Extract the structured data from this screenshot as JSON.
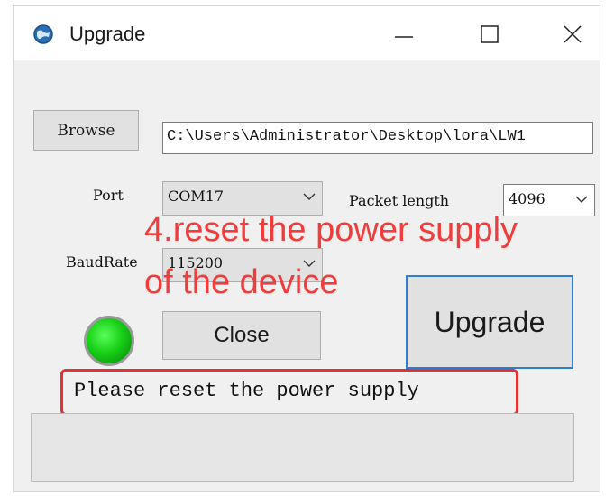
{
  "window": {
    "title": "Upgrade",
    "controls": [
      "minimize-icon",
      "maximize-icon",
      "close-icon"
    ]
  },
  "browse": {
    "button_label": "Browse",
    "path_value": "C:\\Users\\Administrator\\Desktop\\lora\\LW1"
  },
  "port": {
    "label": "Port",
    "selected": "COM17"
  },
  "packet_length": {
    "label": "Packet length",
    "selected": "4096"
  },
  "baudrate": {
    "label": "BaudRate",
    "selected": "115200"
  },
  "close_button_label": "Close",
  "upgrade_button_label": "Upgrade",
  "annotation": {
    "line1": "4.reset the power supply",
    "line2": "of the device",
    "color": "#f03c3c"
  },
  "status": {
    "text": "Please reset the power supply",
    "highlight_color": "#e53333"
  },
  "connection_led_color": "#18d018",
  "progress": {
    "value": 0
  }
}
